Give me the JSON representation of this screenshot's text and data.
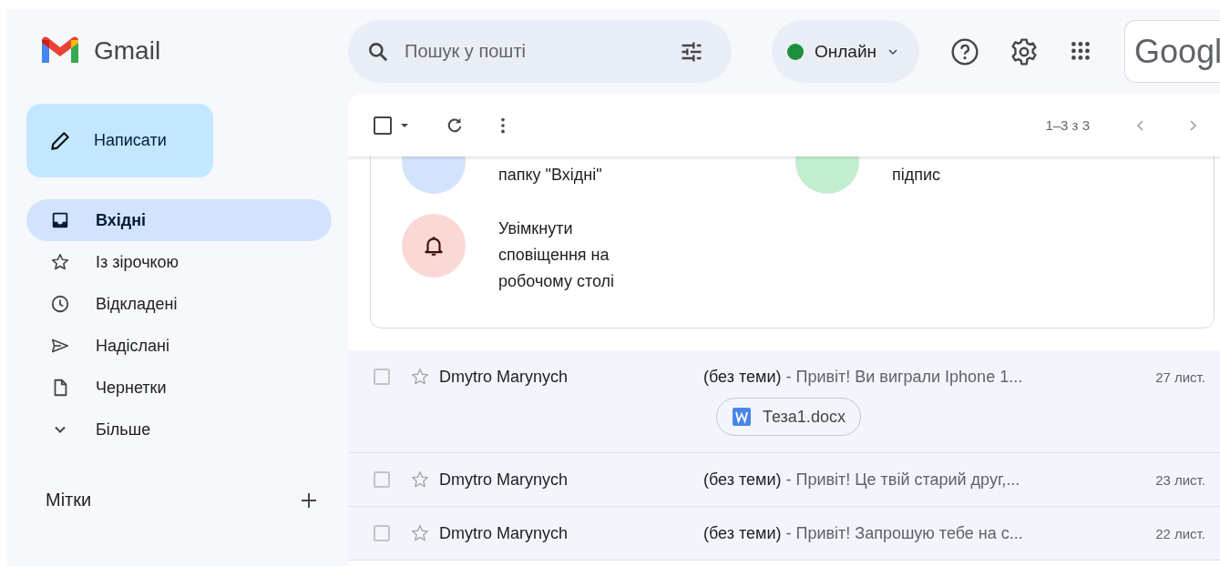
{
  "app": {
    "name": "Gmail"
  },
  "compose": {
    "label": "Написати"
  },
  "sidebar": {
    "items": [
      {
        "label": "Вхідні",
        "kind": "inbox",
        "selected": true
      },
      {
        "label": "Із зірочкою",
        "kind": "star",
        "selected": false
      },
      {
        "label": "Відкладені",
        "kind": "clock",
        "selected": false
      },
      {
        "label": "Надіслані",
        "kind": "send",
        "selected": false
      },
      {
        "label": "Чернетки",
        "kind": "draft",
        "selected": false
      },
      {
        "label": "Більше",
        "kind": "more",
        "selected": false
      }
    ],
    "labels_title": "Мітки"
  },
  "search": {
    "placeholder": "Пошук у пошті"
  },
  "status": {
    "label": "Онлайн",
    "color": "#1e8e3e"
  },
  "account": {
    "label": "Googl"
  },
  "toolbar": {
    "select_all": {
      "checked": false
    },
    "pagination": "1–3 з 3"
  },
  "promo": {
    "tiles": [
      {
        "text": "папку \"Вхідні\"",
        "color": "#d3e3fd",
        "kind": "plain"
      },
      {
        "text": "підпис",
        "color": "#c4eed0",
        "kind": "plain"
      },
      {
        "text": "Увімкнути сповіщення на робочому столі",
        "color": "#fad8d5",
        "kind": "bell"
      }
    ]
  },
  "messages": [
    {
      "sender": "Dmytro Marynych",
      "subject": "(без теми)",
      "snippet": "- Привіт! Ви виграли Iphone 1...",
      "date": "27 лист.",
      "checked": false,
      "starred": false,
      "attachment": "Теза1.docx"
    },
    {
      "sender": "Dmytro Marynych",
      "subject": "(без теми)",
      "snippet": "- Привіт! Це твій старий друг,...",
      "date": "23 лист.",
      "checked": false,
      "starred": false
    },
    {
      "sender": "Dmytro Marynych",
      "subject": "(без теми)",
      "snippet": "- Привіт! Запрошую тебе на с...",
      "date": "22 лист.",
      "checked": false,
      "starred": false
    }
  ]
}
